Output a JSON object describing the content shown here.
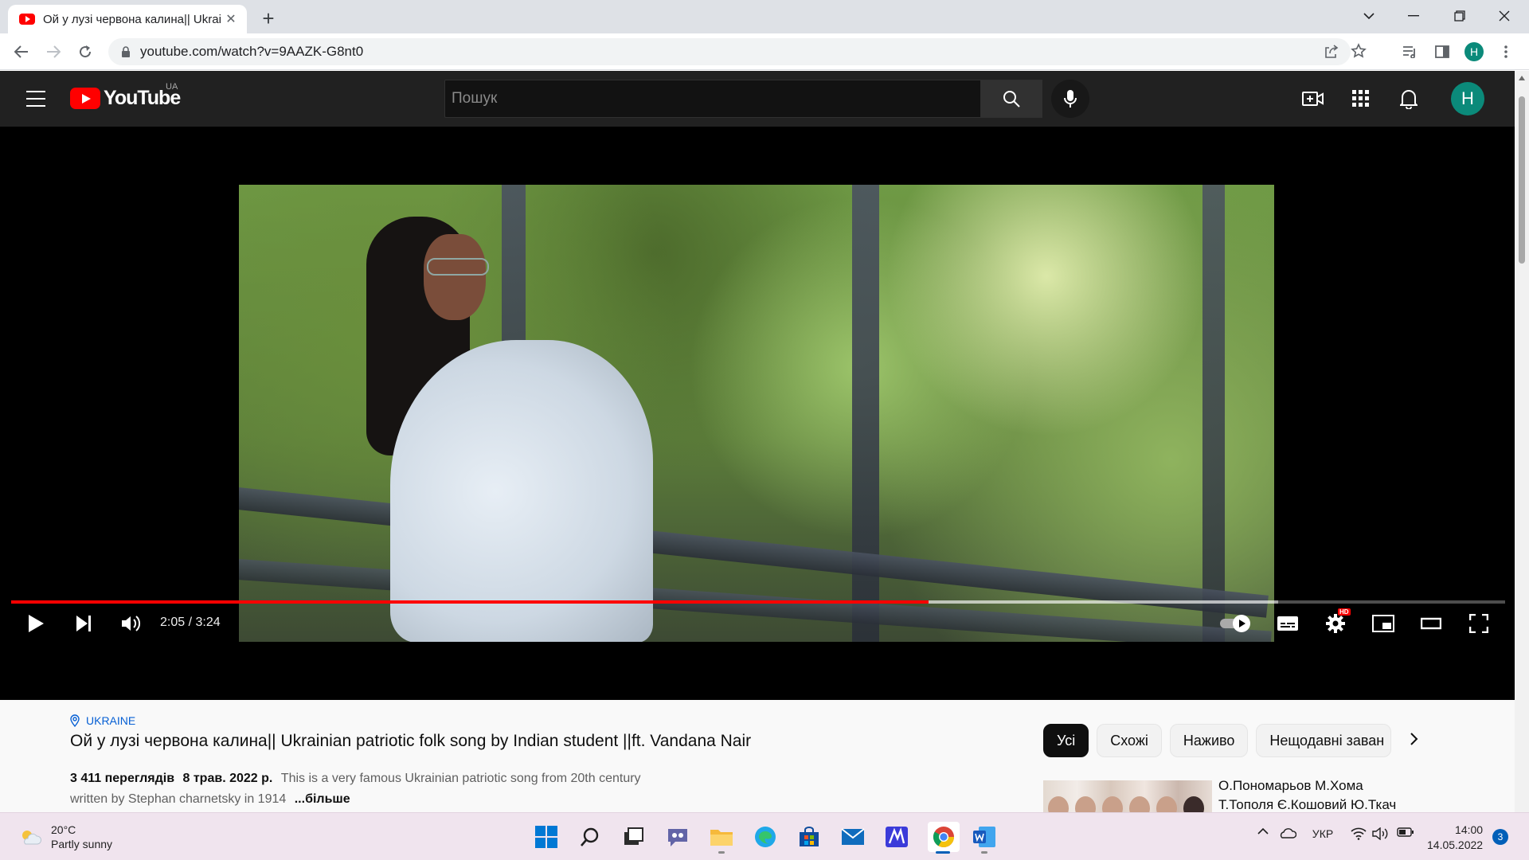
{
  "browser": {
    "tab_title": "Ой у лузі червона калина|| Ukrai",
    "url": "youtube.com/watch?v=9AAZK-G8nt0",
    "profile_initial": "H"
  },
  "youtube": {
    "logo_text": "YouTube",
    "country_code": "UA",
    "search_placeholder": "Пошук",
    "avatar_initial": "H"
  },
  "player": {
    "time": "2:05 / 3:24",
    "played_fraction": 0.614,
    "buffered_fraction": 0.848,
    "settings_badge": "HD"
  },
  "video": {
    "location": "UKRAINE",
    "title": "Ой у лузі червона калина|| Ukrainian patriotic folk song by Indian student ||ft. Vandana Nair",
    "views": "3 411 переглядів",
    "date": "8 трав. 2022 р.",
    "description": "This is a very famous Ukrainian patriotic song from 20th century written by Stephan charnetsky in 1914",
    "more": "...більше"
  },
  "chips": [
    {
      "label": "Усі",
      "active": true
    },
    {
      "label": "Схожі",
      "active": false
    },
    {
      "label": "Наживо",
      "active": false
    },
    {
      "label": "Нещодавні заван",
      "active": false
    }
  ],
  "recommendation": {
    "title": "О.Пономарьов М.Хома",
    "subtitle": "Т.Тополя Є.Кошовий Ю.Ткач"
  },
  "taskbar": {
    "temperature": "20°C",
    "weather": "Partly sunny",
    "language": "УКР",
    "time": "14:00",
    "date": "14.05.2022",
    "notifications": "3"
  },
  "colors": {
    "youtube_red": "#ff0000",
    "progress_played": "#ff0000",
    "link_blue": "#065fd4",
    "windows_accent": "#005fb8"
  }
}
